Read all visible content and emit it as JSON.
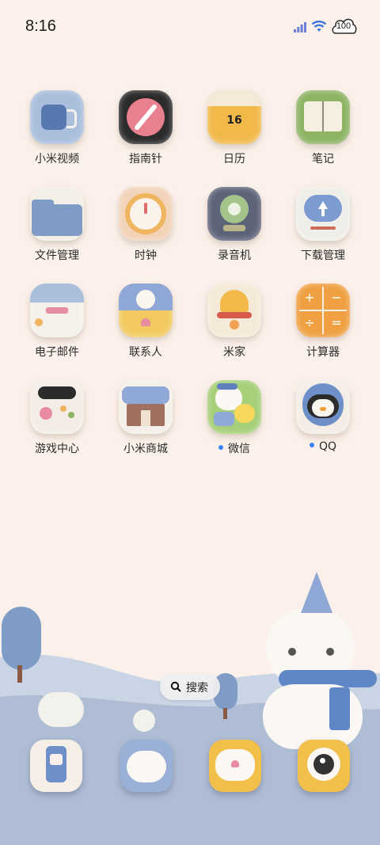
{
  "status": {
    "time": "8:16",
    "battery": "100"
  },
  "apps": [
    {
      "label": "小米视频",
      "notify": false
    },
    {
      "label": "指南针",
      "notify": false
    },
    {
      "label": "日历",
      "notify": false,
      "badge": "16"
    },
    {
      "label": "笔记",
      "notify": false
    },
    {
      "label": "文件管理",
      "notify": false
    },
    {
      "label": "时钟",
      "notify": false
    },
    {
      "label": "录音机",
      "notify": false
    },
    {
      "label": "下载管理",
      "notify": false
    },
    {
      "label": "电子邮件",
      "notify": false
    },
    {
      "label": "联系人",
      "notify": false
    },
    {
      "label": "米家",
      "notify": false
    },
    {
      "label": "计算器",
      "notify": false
    },
    {
      "label": "游戏中心",
      "notify": false
    },
    {
      "label": "小米商城",
      "notify": false
    },
    {
      "label": "微信",
      "notify": true
    },
    {
      "label": "QQ",
      "notify": true
    }
  ],
  "search": {
    "label": "搜索"
  },
  "dock": [
    {
      "icon": "phone-icon"
    },
    {
      "icon": "messages-icon"
    },
    {
      "icon": "chat-icon"
    },
    {
      "icon": "camera-icon"
    }
  ],
  "colors": {
    "background": "#fbf1ea",
    "notify_dot": "#3b82f6"
  }
}
